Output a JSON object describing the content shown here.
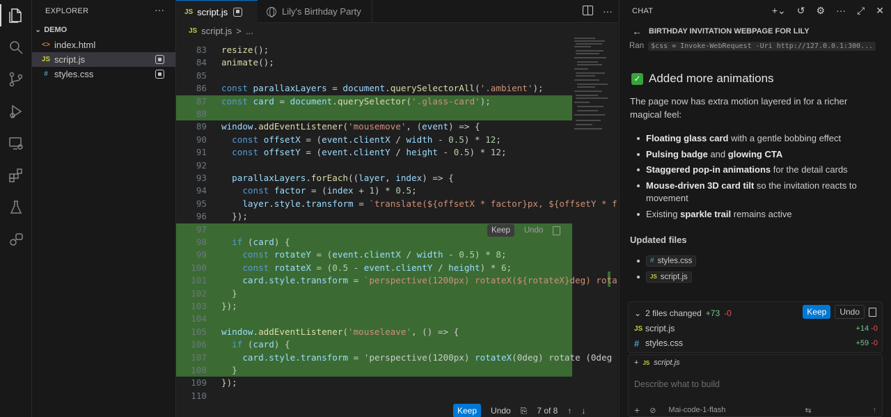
{
  "sidebar": {
    "title": "EXPLORER",
    "more": "···",
    "folder": "DEMO",
    "files": [
      {
        "name": "index.html",
        "icon": "<>",
        "icon_color": "#e37933",
        "selected": false,
        "modified": false
      },
      {
        "name": "script.js",
        "icon": "JS",
        "icon_color": "#cbcb41",
        "selected": true,
        "modified": true
      },
      {
        "name": "styles.css",
        "icon": "#",
        "icon_color": "#519aba",
        "selected": false,
        "modified": true
      }
    ]
  },
  "editor": {
    "tabs": [
      {
        "label": "script.js",
        "icon": "JS",
        "active": true
      },
      {
        "label": "Lily's Birthday Party",
        "icon": "globe-icon",
        "active": false
      }
    ],
    "breadcrumb": {
      "file": "script.js",
      "sep": ">",
      "rest": "..."
    },
    "inline_keep": "Keep",
    "inline_undo": "Undo",
    "bottom": {
      "keep": "Keep",
      "undo": "Undo",
      "position": "7 of 8"
    }
  },
  "code_lines": [
    {
      "n": "83",
      "t": "resize();"
    },
    {
      "n": "84",
      "t": "animate();"
    },
    {
      "n": "85",
      "t": ""
    },
    {
      "n": "86",
      "t": "const parallaxLayers = document.querySelectorAll('.ambient');"
    },
    {
      "n": "87",
      "t": "const card = document.querySelector('.glass-card');"
    },
    {
      "n": "88",
      "t": ""
    },
    {
      "n": "89",
      "t": "window.addEventListener('mousemove', (event) => {"
    },
    {
      "n": "90",
      "t": "  const offsetX = (event.clientX / width - 0.5) * 12;"
    },
    {
      "n": "91",
      "t": "  const offsetY = (event.clientY / height - 0.5) * 12;"
    },
    {
      "n": "92",
      "t": ""
    },
    {
      "n": "93",
      "t": "  parallaxLayers.forEach((layer, index) => {"
    },
    {
      "n": "94",
      "t": "    const factor = (index + 1) * 0.5;"
    },
    {
      "n": "95",
      "t": "    layer.style.transform = `translate(${offsetX * factor}px, ${offsetY * f"
    },
    {
      "n": "96",
      "t": "  });"
    },
    {
      "n": "97",
      "t": ""
    },
    {
      "n": "98",
      "t": "  if (card) {"
    },
    {
      "n": "99",
      "t": "    const rotateY = (event.clientX / width - 0.5) * 8;"
    },
    {
      "n": "100",
      "t": "    const rotateX = (0.5 - event.clientY / height) * 6;"
    },
    {
      "n": "101",
      "t": "    card.style.transform = `perspective(1200px) rotateX(${rotateX}deg) rota"
    },
    {
      "n": "102",
      "t": "  }"
    },
    {
      "n": "103",
      "t": "});"
    },
    {
      "n": "104",
      "t": ""
    },
    {
      "n": "105",
      "t": "window.addEventListener('mouseleave', () => {"
    },
    {
      "n": "106",
      "t": "  if (card) {"
    },
    {
      "n": "107",
      "t": "    card.style.transform = 'perspective(1200px) rotateX(0deg) rotate (0deg"
    },
    {
      "n": "108",
      "t": "  }"
    },
    {
      "n": "109",
      "t": "});"
    },
    {
      "n": "110",
      "t": ""
    }
  ],
  "chat": {
    "header": "CHAT",
    "title": "BIRTHDAY INVITATION WEBPAGE FOR LILY",
    "ran_label": "Ran",
    "ran_cmd": "$css = Invoke-WebRequest -Uri http://127.0.0.1:300...",
    "heading": "Added more animations",
    "intro": "The page now has extra motion layered in for a richer magical feel:",
    "bullets": [
      {
        "bold": "Floating glass card",
        "rest": " with a gentle bobbing effect"
      },
      {
        "bold": "Pulsing badge",
        "rest": " and ",
        "bold2": "glowing CTA"
      },
      {
        "bold": "Staggered pop-in animations",
        "rest": " for the detail cards"
      },
      {
        "bold": "Mouse-driven 3D card tilt",
        "rest": " so the invitation reacts to movement"
      },
      {
        "pre": "Existing ",
        "bold": "sparkle trail",
        "rest": " remains active"
      }
    ],
    "updated_title": "Updated files",
    "updated_files": [
      "styles.css",
      "script.js"
    ],
    "changes": {
      "summary": "2 files changed",
      "plus": "+73",
      "minus": "-0",
      "keep": "Keep",
      "undo": "Undo",
      "rows": [
        {
          "name": "script.js",
          "plus": "+14",
          "minus": "-0"
        },
        {
          "name": "styles.css",
          "plus": "+59",
          "minus": "-0"
        }
      ]
    },
    "attach_file": "script.js",
    "placeholder": "Describe what to build",
    "model": "Mai-code-1-flash"
  }
}
